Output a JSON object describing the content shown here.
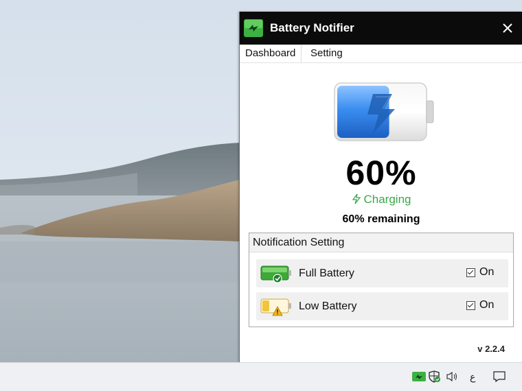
{
  "window": {
    "title": "Battery Notifier",
    "tabs": [
      {
        "label": "Dashboard",
        "active": true
      },
      {
        "label": "Setting",
        "active": false
      }
    ]
  },
  "dashboard": {
    "percent_text": "60%",
    "charge_level": 0.6,
    "status": "Charging",
    "remaining": "60% remaining"
  },
  "notification_setting": {
    "title": "Notification Setting",
    "rows": [
      {
        "label": "Full Battery",
        "checked": true,
        "toggle_label": "On",
        "icon": "battery-full-check-icon"
      },
      {
        "label": "Low Battery",
        "checked": true,
        "toggle_label": "On",
        "icon": "battery-low-warning-icon"
      }
    ]
  },
  "footer": {
    "version": "v 2.2.4"
  },
  "taskbar": {
    "tray_icons": [
      "battery-notifier-tray-icon",
      "security-shield-icon",
      "volume-icon",
      "language-indicator",
      "action-center-icon"
    ],
    "language": "ع"
  },
  "colors": {
    "titlebar": "#0b0b0b",
    "charging_green": "#3aa84a",
    "battery_blue": "#2f7fe0"
  }
}
